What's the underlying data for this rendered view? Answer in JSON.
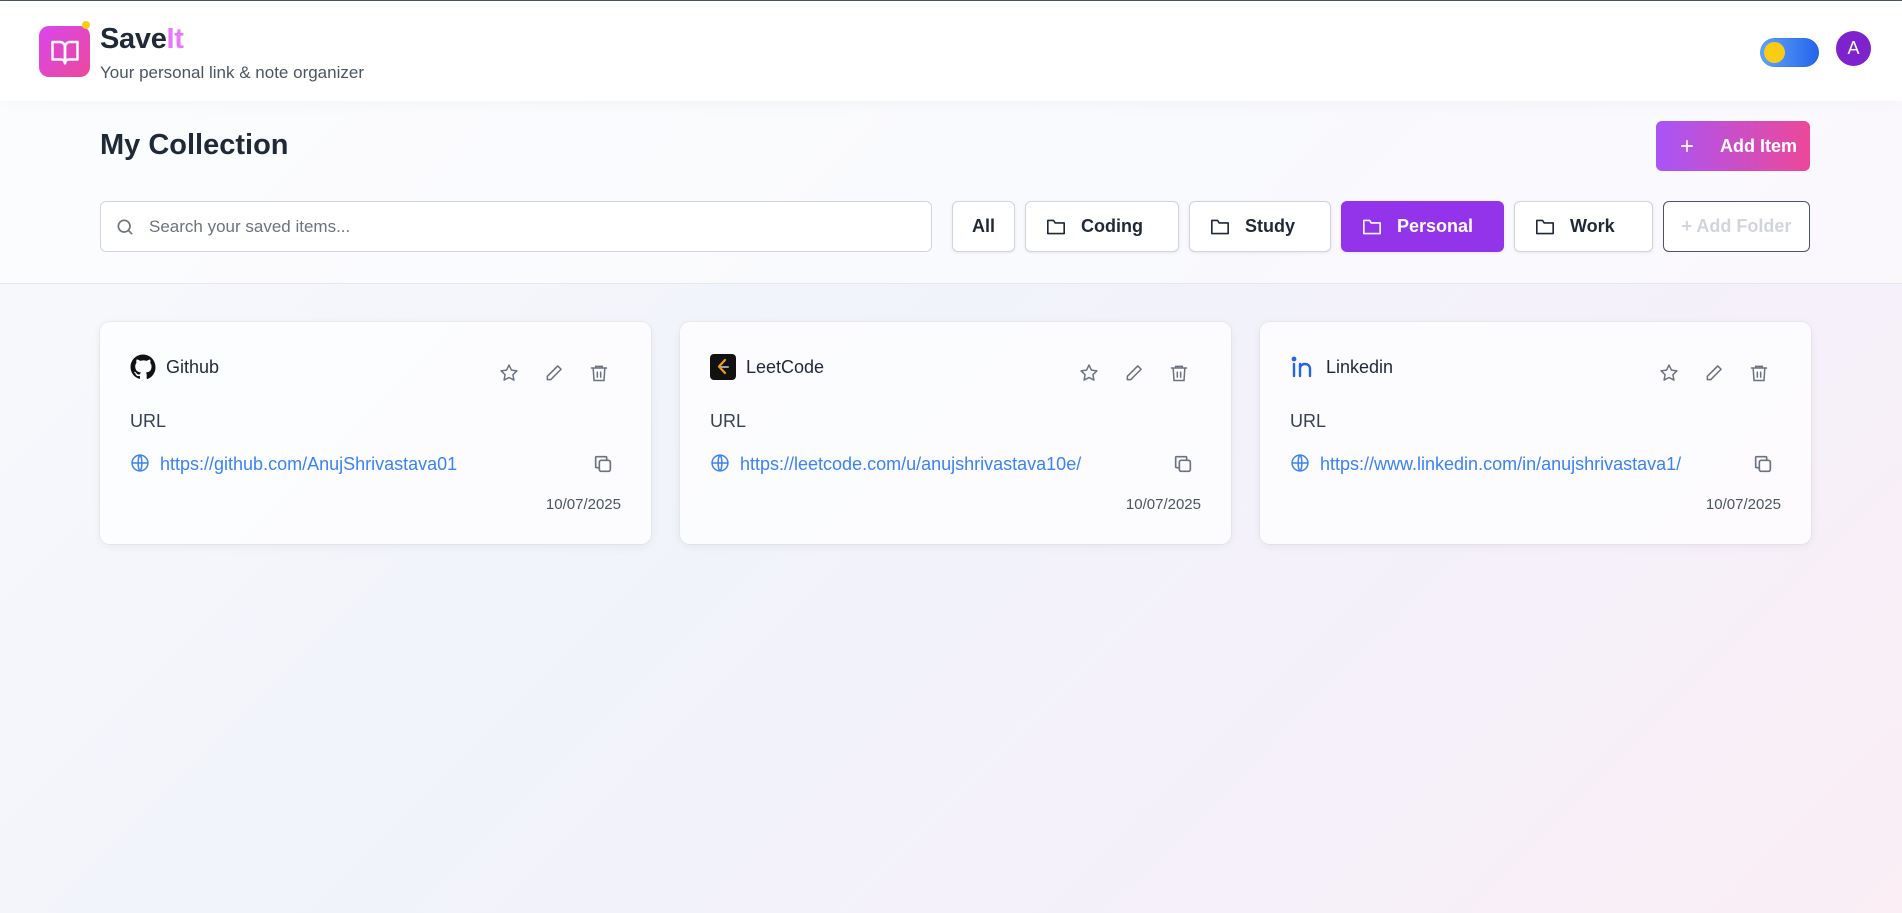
{
  "app": {
    "brand_main": "Save",
    "brand_accent": "It",
    "tagline": "Your personal link & note organizer",
    "avatar_initial": "A",
    "theme_toggle": "on"
  },
  "main": {
    "title": "My Collection",
    "add_item_label": "Add Item",
    "search_placeholder": "Search your saved items..."
  },
  "filters": [
    {
      "label": "All",
      "icon": "none",
      "active": false
    },
    {
      "label": "Coding",
      "icon": "folder-icon",
      "active": false
    },
    {
      "label": "Study",
      "icon": "folder-icon",
      "active": false
    },
    {
      "label": "Personal",
      "icon": "folder-icon",
      "active": true
    },
    {
      "label": "Work",
      "icon": "folder-icon",
      "active": false
    }
  ],
  "add_folder_label": "+ Add Folder",
  "items": [
    {
      "name": "Github",
      "icon": "github-icon",
      "type": "URL",
      "url": "https://github.com/AnujShrivastava01",
      "date": "10/07/2025"
    },
    {
      "name": "LeetCode",
      "icon": "leetcode-icon",
      "type": "URL",
      "url": "https://leetcode.com/u/anujshrivastava10e/",
      "date": "10/07/2025"
    },
    {
      "name": "Linkedin",
      "icon": "linkedin-icon",
      "type": "URL",
      "url": "https://www.linkedin.com/in/anujshrivastava1/",
      "date": "10/07/2025"
    }
  ],
  "colors": {
    "accent_purple": "#9333ea",
    "gradient_start": "#a855f7",
    "gradient_end": "#ec4899",
    "link_blue": "#3b82f6"
  }
}
